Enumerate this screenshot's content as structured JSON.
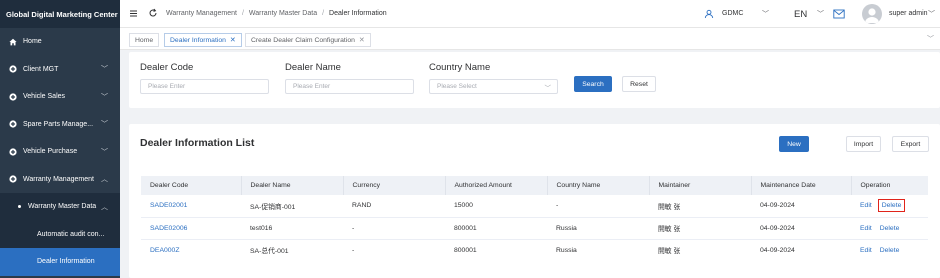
{
  "app": {
    "title": "Global Digital Marketing Center"
  },
  "sidebar": {
    "items": [
      {
        "label": "Home",
        "icon": "home-icon"
      },
      {
        "label": "Client MGT",
        "icon": "plus-circle-icon"
      },
      {
        "label": "Vehicle Sales",
        "icon": "plus-circle-icon"
      },
      {
        "label": "Spare Parts Manage...",
        "icon": "plus-circle-icon"
      },
      {
        "label": "Vehicle Purchase",
        "icon": "plus-circle-icon"
      },
      {
        "label": "Warranty Management",
        "icon": "plus-circle-icon"
      }
    ],
    "sub_item": {
      "label": "Warranty Master Data"
    },
    "leaf_items": [
      {
        "label": "Automatic audit con..."
      },
      {
        "label": "Dealer Information"
      }
    ]
  },
  "header": {
    "breadcrumb": [
      "Warranty Management",
      "Warranty Master Data",
      "Dealer Information"
    ],
    "org": "GDMC",
    "lang": "EN",
    "username": "super admin"
  },
  "tabs": [
    {
      "label": "Home"
    },
    {
      "label": "Dealer Information"
    },
    {
      "label": "Create Dealer Claim Configuration"
    }
  ],
  "search": {
    "dealer_code": {
      "label": "Dealer Code",
      "placeholder": "Please Enter"
    },
    "dealer_name": {
      "label": "Dealer Name",
      "placeholder": "Please Enter"
    },
    "country_name": {
      "label": "Country Name",
      "placeholder": "Please Select"
    },
    "search_label": "Search",
    "reset_label": "Reset"
  },
  "list": {
    "title": "Dealer Information List",
    "new_label": "New",
    "import_label": "Import",
    "export_label": "Export",
    "columns": [
      "Dealer Code",
      "Dealer Name",
      "Currency",
      "Authorized Amount",
      "Country Name",
      "Maintainer",
      "Maintenance Date",
      "Operation"
    ],
    "rows": [
      {
        "code": "SADE02001",
        "name": "SA-促销商-001",
        "currency": "RAND",
        "amount": "15000",
        "country": "-",
        "maintainer": "開敏 张",
        "date": "04-09-2024",
        "edit": "Edit",
        "delete": "Delete"
      },
      {
        "code": "SADE02006",
        "name": "test016",
        "currency": "-",
        "amount": "800001",
        "country": "Russia",
        "maintainer": "開敏 张",
        "date": "04-09-2024",
        "edit": "Edit",
        "delete": "Delete"
      },
      {
        "code": "DEA000Z",
        "name": "SA-总代-001",
        "currency": "-",
        "amount": "800001",
        "country": "Russia",
        "maintainer": "開敏 张",
        "date": "04-09-2024",
        "edit": "Edit",
        "delete": "Delete"
      }
    ]
  },
  "colors": {
    "primary": "#2b6fc1",
    "sidebar_bg": "#2b3a4a",
    "highlight": "#e0241b"
  }
}
